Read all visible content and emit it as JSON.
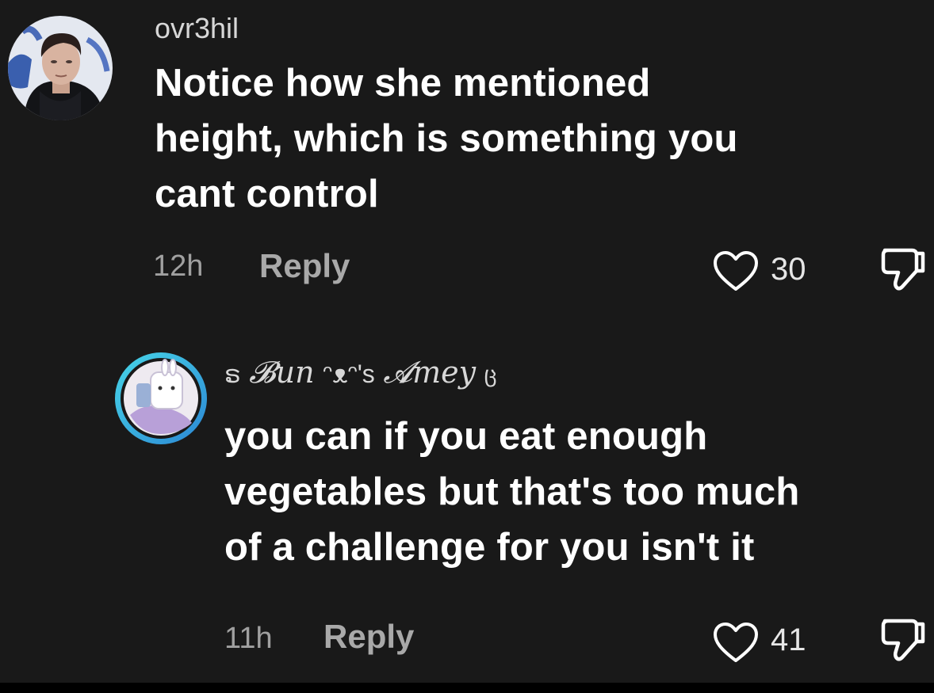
{
  "colors": {
    "background": "#191919",
    "text_primary": "#ffffff",
    "text_secondary": "#a0a0a0",
    "ring_gradient_start": "#47d6e8",
    "ring_gradient_end": "#2c87d4"
  },
  "comments": [
    {
      "username": "ovr3hil",
      "text": "Notice how she mentioned\nheight, which is something you\ncant control",
      "time": "12h",
      "reply_label": "Reply",
      "likes": "30",
      "icons": {
        "like": "heart-outline-icon",
        "dislike": "thumbs-down-icon"
      }
    },
    {
      "username_prefix": "ຣ",
      "username_main": "𝓑un",
      "username_mid": "ᵔᴥᵔ's",
      "username_end": "𝓐mey",
      "username_badge": "ც",
      "text": "you can if you eat enough\nvegetables but that's too much\nof a challenge for you isn't it",
      "time": "11h",
      "reply_label": "Reply",
      "likes": "41",
      "icons": {
        "like": "heart-outline-icon",
        "dislike": "thumbs-down-icon"
      }
    }
  ]
}
